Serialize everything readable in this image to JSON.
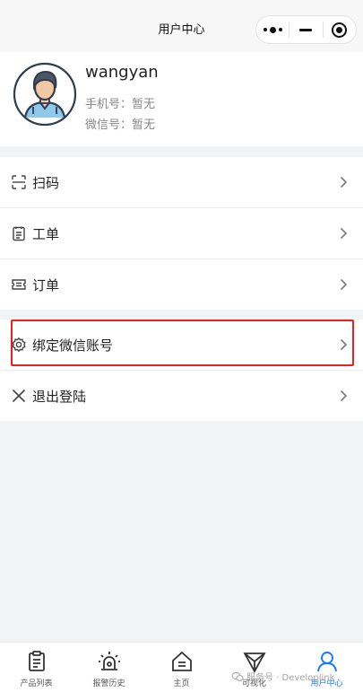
{
  "nav": {
    "title": "用户中心"
  },
  "profile": {
    "username": "wangyan",
    "phone": "手机号：暂无",
    "wechat": "微信号：暂无"
  },
  "menu": {
    "scan": "扫码",
    "workorder": "工单",
    "order": "订单",
    "bind_wechat": "绑定微信账号",
    "logout": "退出登陆"
  },
  "tabbar": {
    "products": "产品列表",
    "alarm": "报警历史",
    "home": "主页",
    "visual": "可视化",
    "user": "用户中心"
  },
  "watermark": "服务号 · Developlink",
  "colors": {
    "accent": "#1677ff",
    "highlight": "#e8231e"
  }
}
